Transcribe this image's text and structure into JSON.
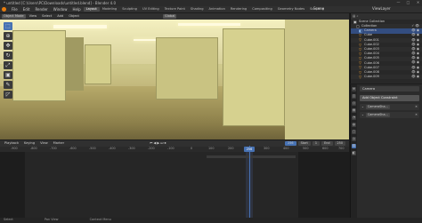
{
  "window": {
    "title": "* untitled [C:\\Users\\PC\\Downloads\\untitled.blend] - Blender 4.0",
    "controls": [
      "—",
      "□",
      "✕"
    ]
  },
  "menubar": {
    "menus": [
      "File",
      "Edit",
      "Render",
      "Window",
      "Help"
    ],
    "workspaces": [
      "Layout",
      "Modeling",
      "Sculpting",
      "UV Editing",
      "Texture Paint",
      "Shading",
      "Animation",
      "Rendering",
      "Compositing",
      "Geometry Nodes",
      "Scripting"
    ],
    "scene": "Scene",
    "view_layer": "ViewLayer"
  },
  "viewport_header": {
    "mode": "Object Mode",
    "menus": [
      "View",
      "Select",
      "Add",
      "Object"
    ],
    "transform": "Global"
  },
  "tools": [
    "select-box",
    "cursor",
    "move",
    "rotate",
    "scale",
    "transform",
    "annotate",
    "measure"
  ],
  "outliner": {
    "title": "Scene Collection",
    "items": [
      {
        "name": "Collection",
        "type": "collection"
      },
      {
        "name": "Camera",
        "type": "camera"
      },
      {
        "name": "Cube",
        "type": "mesh"
      },
      {
        "name": "Cube.001",
        "type": "mesh"
      },
      {
        "name": "Cube.002",
        "type": "mesh"
      },
      {
        "name": "Cube.003",
        "type": "mesh"
      },
      {
        "name": "Cube.004",
        "type": "mesh"
      },
      {
        "name": "Cube.005",
        "type": "mesh"
      },
      {
        "name": "Cube.006",
        "type": "mesh"
      },
      {
        "name": "Cube.007",
        "type": "mesh"
      },
      {
        "name": "Cube.008",
        "type": "mesh"
      },
      {
        "name": "Cube.009",
        "type": "mesh"
      }
    ]
  },
  "properties": {
    "object_name": "Camera",
    "add_modifier": "Add Object Constraint",
    "constraints": [
      {
        "name": "CameraSha..."
      },
      {
        "name": "CameraSha..."
      }
    ]
  },
  "timeline": {
    "menus": [
      "Playback",
      "Keying",
      "View",
      "Marker"
    ],
    "current_frame": "256",
    "start_label": "Start",
    "start": "1",
    "end_label": "End",
    "end": "250",
    "ticks": [
      "-900",
      "-800",
      "-700",
      "-600",
      "-500",
      "-400",
      "-300",
      "-200",
      "-100",
      "0",
      "100",
      "200",
      "300",
      "400",
      "500",
      "600",
      "700",
      "800"
    ]
  },
  "statusbar": {
    "items": [
      "Select",
      "Pan View",
      "Context Menu"
    ]
  }
}
